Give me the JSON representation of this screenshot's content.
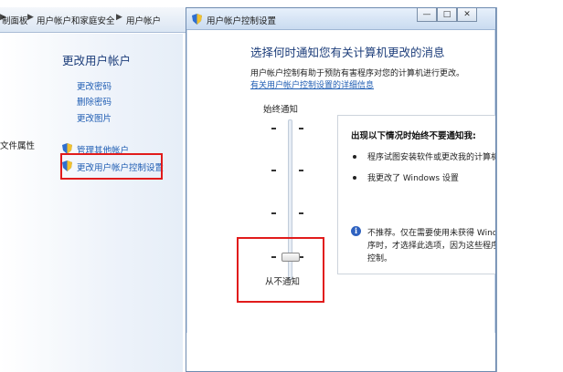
{
  "breadcrumb": {
    "items": [
      "制面板",
      "用户帐户和家庭安全",
      "用户帐户"
    ]
  },
  "left_pane": {
    "title": "更改用户帐户",
    "links": [
      "更改密码",
      "删除密码",
      "更改图片"
    ],
    "side_text": "文件属性",
    "shield_links": [
      "管理其他帐户",
      "更改用户帐户控制设置"
    ]
  },
  "dialog": {
    "title": "用户帐户控制设置",
    "heading": "选择何时通知您有关计算机更改的消息",
    "description": "用户帐户控制有助于预防有害程序对您的计算机进行更改。",
    "link": "有关用户帐户控制设置的详细信息",
    "slider": {
      "top_label": "始终通知",
      "bottom_label": "从不通知",
      "level_index": 3,
      "level_count": 4
    },
    "info": {
      "header": "出现以下情况时始终不要通知我:",
      "bullets": [
        "程序试图安装软件或更改我的计算机",
        "我更改了 Windows 设置"
      ],
      "note_lines": [
        "不推荐。仅在需要使用未获得 Windo",
        "序时，才选择此选项，因为这些程序",
        "控制。"
      ]
    },
    "window_buttons": [
      "—",
      "□",
      "✕"
    ]
  },
  "colors": {
    "highlight": "#e11b1b",
    "link": "#1f5db3",
    "heading": "#1c3d7a"
  },
  "icons": {
    "shield": "uac-shield-icon",
    "info": "info-icon"
  }
}
